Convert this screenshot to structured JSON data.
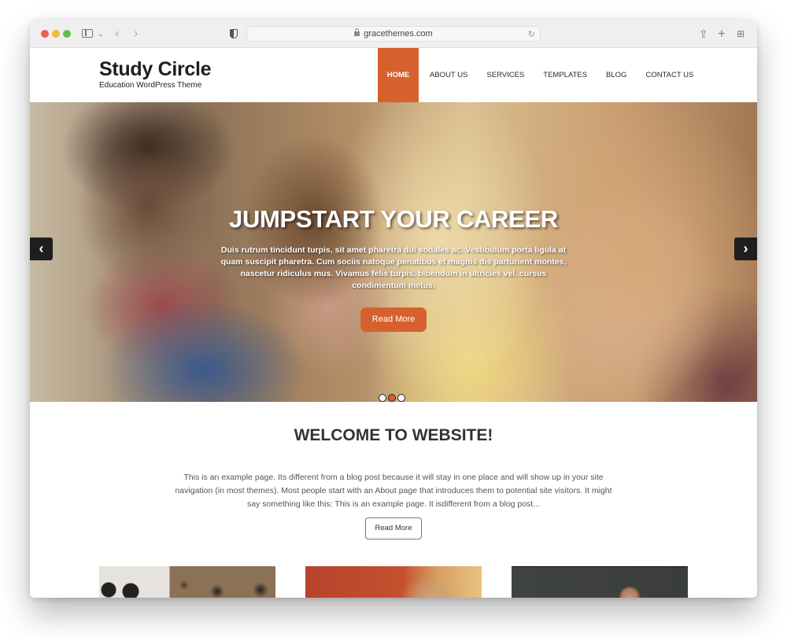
{
  "browser": {
    "url": "gracethemes.com",
    "icons": [
      "sidebar-icon",
      "chevron-down-icon",
      "back-icon",
      "forward-icon",
      "shield-icon",
      "lock-icon",
      "reload-icon",
      "share-icon",
      "new-tab-icon",
      "tab-overview-icon"
    ]
  },
  "site": {
    "title": "Study Circle",
    "tagline": "Education WordPress Theme",
    "accent_color": "#d6612f"
  },
  "nav": {
    "items": [
      {
        "label": "HOME",
        "active": true
      },
      {
        "label": "ABOUT US"
      },
      {
        "label": "SERVICES"
      },
      {
        "label": "TEMPLATES"
      },
      {
        "label": "BLOG"
      },
      {
        "label": "CONTACT US"
      }
    ]
  },
  "hero": {
    "title": "JUMPSTART YOUR CAREER",
    "text": "Duis rutrum tincidunt turpis, sit amet pharetra dui sodales ac. Vestibulum porta ligula at quam suscipit pharetra. Cum sociis natoque penatibus et magnis dis parturient montes, nascetur ridiculus mus. Vivamus felis turpis, bibendum in ultricies vel, cursus condimentum metus.",
    "button_label": "Read More",
    "prev_arrow": "‹",
    "next_arrow": "›",
    "slides_total": 3,
    "active_slide": 2
  },
  "welcome": {
    "title": "WELCOME TO WEBSITE!",
    "text": "This is an example page. Its different from a blog post because it will stay in one place and will show up in your site navigation (in most themes). Most people start with an About page that introduces them to potential site visitors. It might say something like this: This is an example page. It isdifferent from a blog post...",
    "button_label": "Read More"
  }
}
